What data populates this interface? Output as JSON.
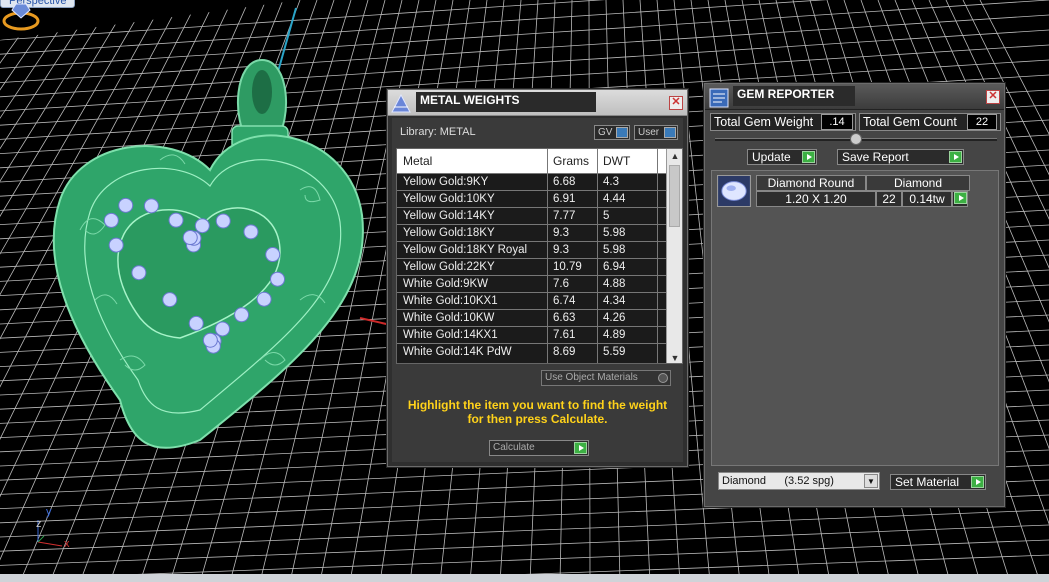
{
  "viewport": {
    "label": "Perspective",
    "axis_labels": {
      "y": "y",
      "z": "z",
      "x": "x"
    },
    "colors": {
      "model": "#2fa56a",
      "grid": "#cfcfcf",
      "gem": "#b8c6ff"
    }
  },
  "metal_weights": {
    "title": "METAL WEIGHTS",
    "library_label": "Library: METAL",
    "toggles": [
      "GV",
      "User"
    ],
    "columns": [
      "Metal",
      "Grams",
      "DWT"
    ],
    "rows": [
      {
        "metal": "Yellow Gold:9KY",
        "grams": "6.68",
        "dwt": "4.3"
      },
      {
        "metal": "Yellow Gold:10KY",
        "grams": "6.91",
        "dwt": "4.44"
      },
      {
        "metal": "Yellow Gold:14KY",
        "grams": "7.77",
        "dwt": "5"
      },
      {
        "metal": "Yellow Gold:18KY",
        "grams": "9.3",
        "dwt": "5.98"
      },
      {
        "metal": "Yellow Gold:18KY Royal",
        "grams": "9.3",
        "dwt": "5.98"
      },
      {
        "metal": "Yellow Gold:22KY",
        "grams": "10.79",
        "dwt": "6.94"
      },
      {
        "metal": "White Gold:9KW",
        "grams": "7.6",
        "dwt": "4.88"
      },
      {
        "metal": "White Gold:10KX1",
        "grams": "6.74",
        "dwt": "4.34"
      },
      {
        "metal": "White Gold:10KW",
        "grams": "6.63",
        "dwt": "4.26"
      },
      {
        "metal": "White Gold:14KX1",
        "grams": "7.61",
        "dwt": "4.89"
      },
      {
        "metal": "White Gold:14K PdW",
        "grams": "8.69",
        "dwt": "5.59"
      }
    ],
    "use_object_materials": "Use Object Materials",
    "hint_line1": "Highlight the item you want to find the weight",
    "hint_line2": "for then press Calculate.",
    "calculate_label": "Calculate",
    "hint_color": "#ffd21a"
  },
  "gem_reporter": {
    "title": "GEM REPORTER",
    "total_gem_weight_label": "Total Gem Weight",
    "total_gem_weight_value": ".14",
    "total_gem_count_label": "Total Gem Count",
    "total_gem_count_value": "22",
    "update_label": "Update",
    "save_report_label": "Save Report",
    "gem": {
      "shape": "Diamond Round",
      "material": "Diamond",
      "size": "1.20 X 1.20",
      "count": "22",
      "weight": "0.14tw"
    },
    "material_select": "Diamond      (3.52 spg)",
    "set_material_label": "Set Material"
  }
}
